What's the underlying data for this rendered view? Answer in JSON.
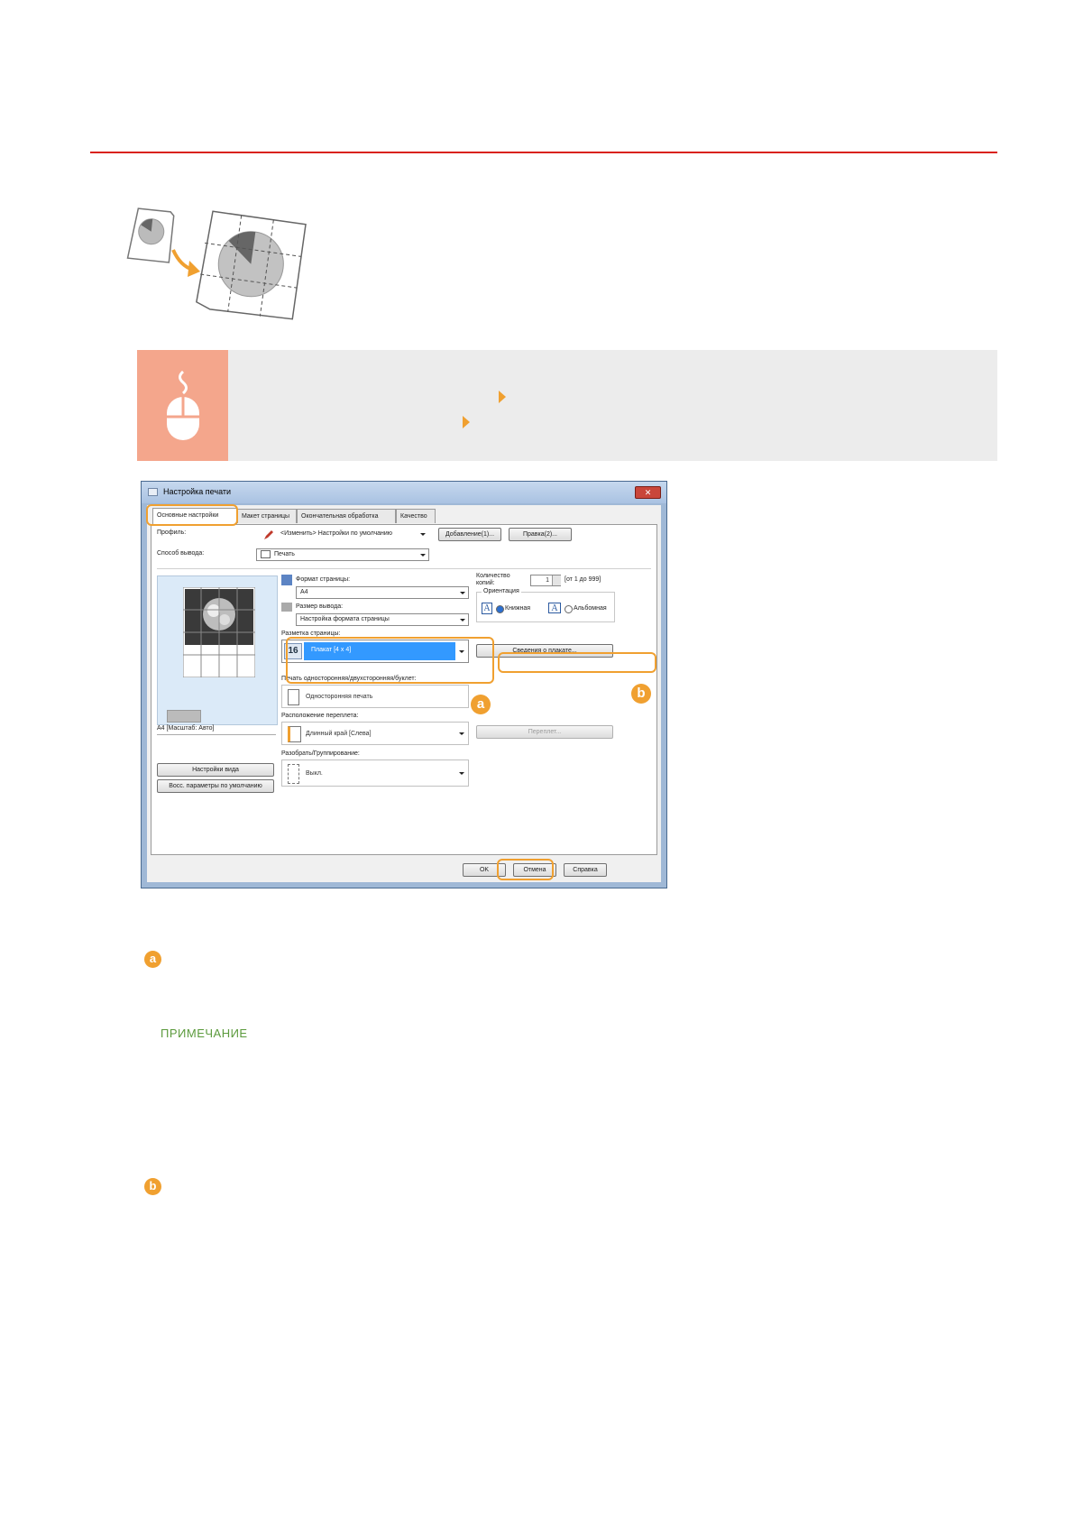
{
  "note_title": "ПРИМЕЧАНИЕ",
  "markers": {
    "a": "a",
    "b": "b"
  },
  "dialog": {
    "title": "Настройка печати",
    "tabs": [
      "Основные настройки",
      "Макет страницы",
      "Окончательная обработка",
      "Качество"
    ],
    "profile": {
      "label": "Профиль:",
      "value": "<Изменить> Настройки по умолчанию",
      "add_button": "Добавление(1)...",
      "edit_button": "Правка(2)..."
    },
    "output_method": {
      "label": "Способ вывода:",
      "value": "Печать"
    },
    "page_size": {
      "label": "Формат страницы:",
      "value": "A4"
    },
    "output_size": {
      "label": "Размер вывода:",
      "value": "Настройка формата страницы"
    },
    "page_layout": {
      "label": "Разметка страницы:",
      "value": "Плакат [4 x 4]",
      "badge": "16"
    },
    "copies": {
      "label_line1": "Количество",
      "label_line2": "копий:",
      "value": "1",
      "range": "[от 1 до 999]"
    },
    "orientation": {
      "label": "Ориентация",
      "portrait": "Книжная",
      "landscape": "Альбомная",
      "icon_letter": "A"
    },
    "poster_details_button": "Сведения о плакате...",
    "duplex": {
      "label": "Печать односторонняя/двухсторонняя/буклет:",
      "value": "Односторонняя печать"
    },
    "binding_location": {
      "label": "Расположение переплета:",
      "value": "Длинный край [Слева]"
    },
    "binding_button": "Переплет...",
    "collate": {
      "label": "Разобрать/Группирование:",
      "value": "Выкл."
    },
    "preview_caption": "A4 [Масштаб: Авто]",
    "view_settings_button": "Настройки вида",
    "restore_defaults_button": "Восс. параметры по умолчанию",
    "ok_button": "OK",
    "cancel_button": "Отмена",
    "help_button": "Справка"
  }
}
